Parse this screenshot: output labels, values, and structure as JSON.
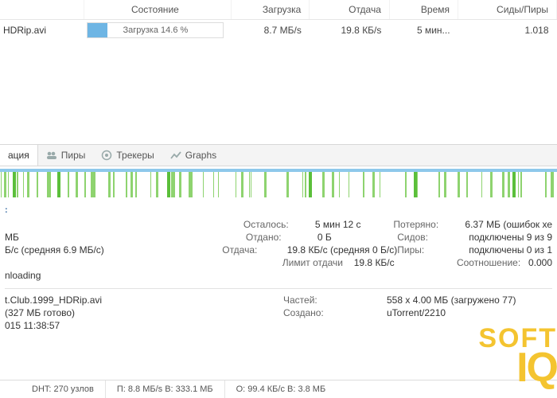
{
  "torrent_list": {
    "columns": {
      "name": "",
      "status": "Состояние",
      "down": "Загрузка",
      "up": "Отдача",
      "eta": "Время",
      "seeds_peers": "Сиды/Пиры"
    },
    "row": {
      "name_fragment": "HDRip.avi",
      "status_label": "Загрузка 14.6 %",
      "progress_pct": 14.6,
      "down": "8.7 МБ/s",
      "up": "19.8 КБ/s",
      "eta": "5 мин...",
      "seeds_peers": "1.018"
    }
  },
  "tabs": {
    "info": "ация",
    "peers": "Пиры",
    "trackers": "Трекеры",
    "graphs": "Graphs"
  },
  "availability_header_fragment": ":",
  "transfer": {
    "left_lines": {
      "size_fragment": "МБ",
      "down_fragment": "Б/с (средняя 6.9 МБ/с)",
      "status_fragment": "nloading"
    },
    "mid": {
      "remaining_label": "Осталось:",
      "remaining_value": "5 мин 12 с",
      "uploaded_label": "Отдано:",
      "uploaded_value": "0 Б",
      "up_speed_label": "Отдача:",
      "up_speed_value": "19.8 КБ/с (средняя 0 Б/с)",
      "up_limit_label": "Лимит отдачи",
      "up_limit_value": "19.8 КБ/с"
    },
    "right": {
      "wasted_label": "Потеряно:",
      "wasted_value": "6.37 МБ (ошибок хе",
      "seeds_label": "Сидов:",
      "seeds_value": "подключены 9 из 9",
      "peers_label": "Пиры:",
      "peers_value": "подключены 0 из 1",
      "ratio_label": "Соотношение:",
      "ratio_value": "0.000"
    }
  },
  "general": {
    "left": {
      "filename_fragment": "t.Club.1999_HDRip.avi",
      "done_fragment": "(327 МБ готово)",
      "added_fragment": "015 11:38:57"
    },
    "right": {
      "pieces_label": "Частей:",
      "pieces_value": "558 x 4.00 МБ (загружено 77)",
      "created_label": "Создано:",
      "created_value": "uTorrent/2210"
    }
  },
  "statusbar": {
    "dht": "DHT: 270 узлов",
    "down": "П: 8.8 МБ/s В: 333.1 МБ",
    "up": "О: 99.4 КБ/с В: 3.8 МБ"
  },
  "watermark": {
    "line1": "SOFT",
    "line2": "IQ"
  }
}
